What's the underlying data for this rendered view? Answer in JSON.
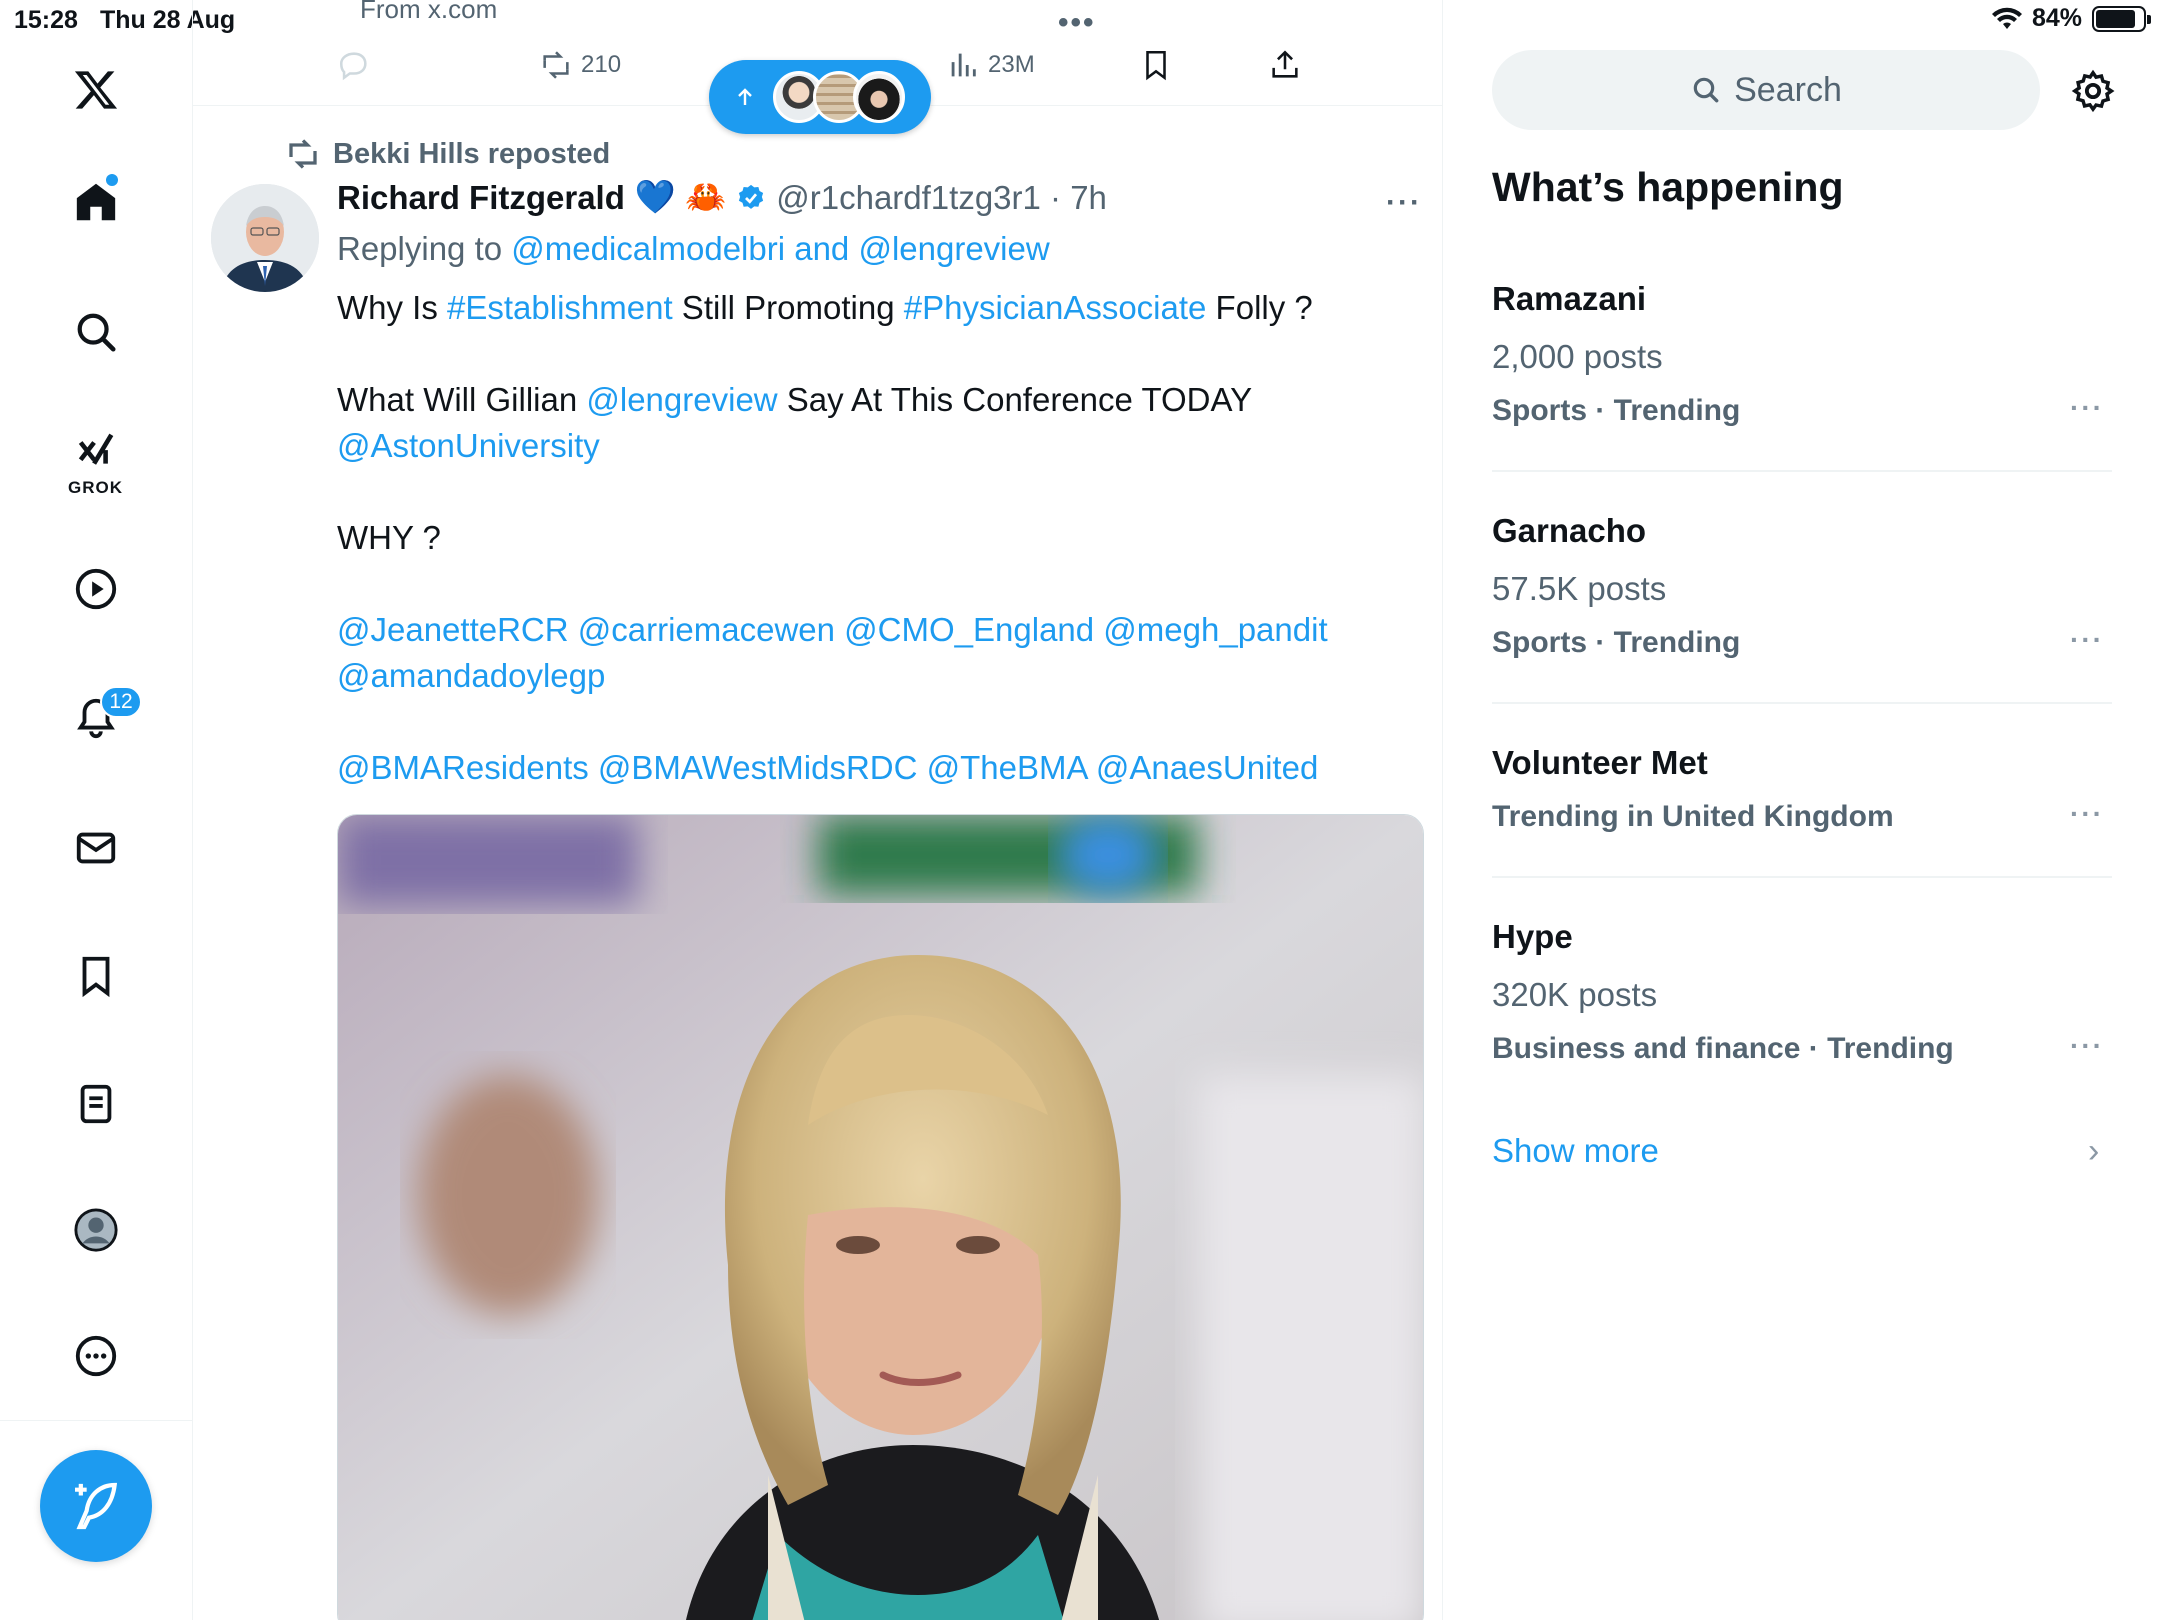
{
  "status": {
    "time": "15:28",
    "date": "Thu 28 Aug",
    "battery": "84%",
    "battery_level": 0.84,
    "from_url": "From x.com"
  },
  "nav": {
    "notifications_badge": "12",
    "grok_label": "GROK"
  },
  "actions": {
    "retweets": "210",
    "views": "23M"
  },
  "tweet": {
    "reposted_by": "Bekki Hills reposted",
    "name": "Richard Fitzgerald",
    "name_emojis": "💙 🦀",
    "handle_time": "@r1chardf1tzg3r1 · 7h",
    "replying_prefix": "Replying to",
    "replying_users": "@medicalmodelbri and @lengreview",
    "line1_a": "Why Is ",
    "line1_tag1": "#Establishment",
    "line1_b": " Still Promoting ",
    "line1_tag2": "#PhysicianAssociate",
    "line1_c": " Folly ?",
    "line2_a": "What Will Gillian ",
    "line2_mention": "@lengreview",
    "line2_b": " Say At This Conference TODAY",
    "line3_mention": "@AstonUniversity",
    "line4": "WHY ?",
    "mentions_1": "@JeanetteRCR @carriemacewen @CMO_England @megh_pandit",
    "mentions_2": "@amandadoylegp",
    "mentions_3": "@BMAResidents @BMAWestMidsRDC @TheBMA @AnaesUnited"
  },
  "search": {
    "placeholder": "Search"
  },
  "whats_happening": {
    "title": "What’s happening",
    "trends": [
      {
        "name": "Ramazani",
        "posts": "2,000 posts",
        "category": "Sports · Trending"
      },
      {
        "name": "Garnacho",
        "posts": "57.5K posts",
        "category": "Sports · Trending"
      },
      {
        "name": "Volunteer Met",
        "posts": "",
        "category": "Trending in United Kingdom"
      },
      {
        "name": "Hype",
        "posts": "320K posts",
        "category": "Business and finance · Trending"
      }
    ],
    "show_more": "Show more"
  }
}
